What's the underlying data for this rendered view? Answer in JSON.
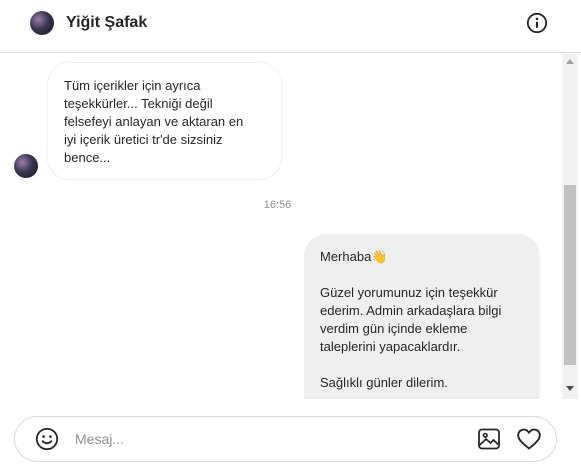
{
  "header": {
    "username": "Yiğit Şafak",
    "avatar_icon": "profile-avatar",
    "info_icon": "info-icon"
  },
  "thread": {
    "incoming": {
      "text": "Tüm içerikler için ayrıca\nteşekkürler... Tekniği değil\nfelsefeyi anlayan ve aktaran en\niyi içerik üretici tr'de sizsiniz\nbence..."
    },
    "timestamp": "16:56",
    "outgoing": {
      "text": "Merhaba👋\n\nGüzel yorumunuz için teşekkür\nederim. Admin arkadaşlara bilgi\nverdim gün içinde ekleme\ntaleplerini yapacaklardır.\n\nSağlıklı günler dilerim."
    }
  },
  "composer": {
    "placeholder": "Mesaj...",
    "value": "",
    "emoji_icon": "smiley-icon",
    "image_icon": "image-icon",
    "like_icon": "heart-icon"
  }
}
